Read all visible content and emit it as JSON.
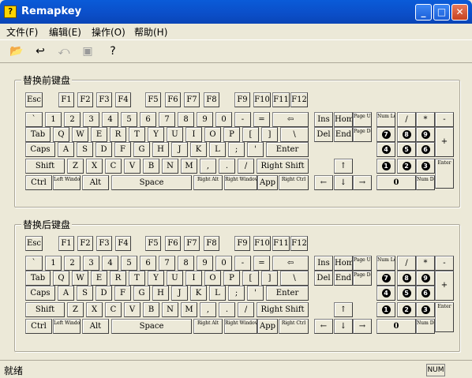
{
  "window": {
    "title": "Remapkey",
    "app_icon": "?"
  },
  "title_buttons": {
    "minimize": "_",
    "maximize": "□",
    "close": "✕"
  },
  "menu": [
    "文件(F)",
    "编辑(E)",
    "操作(O)",
    "帮助(H)"
  ],
  "toolbar_icons": [
    "open-file-icon",
    "reset-icon",
    "revert-icon",
    "stop-icon",
    "help-icon"
  ],
  "sections": [
    {
      "title": "替换前键盘"
    },
    {
      "title": "替换后键盘"
    }
  ],
  "keys": {
    "esc": "Esc",
    "f1": "F1",
    "f2": "F2",
    "f3": "F3",
    "f4": "F4",
    "f5": "F5",
    "f6": "F6",
    "f7": "F7",
    "f8": "F8",
    "f9": "F9",
    "f10": "F10",
    "f11": "F11",
    "f12": "F12",
    "backtick": "`",
    "k1": "1",
    "k2": "2",
    "k3": "3",
    "k4": "4",
    "k5": "5",
    "k6": "6",
    "k7": "7",
    "k8": "8",
    "k9": "9",
    "k0": "0",
    "minus": "-",
    "equals": "=",
    "backspace": "⇦",
    "tab": "Tab",
    "q": "Q",
    "w": "W",
    "e": "E",
    "r": "R",
    "t": "T",
    "y": "Y",
    "u": "U",
    "i": "I",
    "o": "O",
    "p": "P",
    "lbracket": "[",
    "rbracket": "]",
    "backslash": "\\",
    "caps": "Caps",
    "a": "A",
    "s": "S",
    "d": "D",
    "f": "F",
    "g": "G",
    "h": "H",
    "j": "J",
    "k": "K",
    "l": "L",
    "semicolon": ";",
    "quote": "'",
    "enter": "Enter",
    "lshift": "Shift",
    "z": "Z",
    "x": "X",
    "c": "C",
    "v": "V",
    "b": "B",
    "n": "N",
    "m": "M",
    "comma": ",",
    "period": ".",
    "slash": "/",
    "rshift": "Right Shift",
    "ctrl": "Ctrl",
    "lwin": "Left Windows",
    "alt": "Alt",
    "space": "Space",
    "ralt": "Right Alt",
    "rwin": "Right Windows",
    "app": "App",
    "rctrl": "Right Ctrl",
    "ins": "Ins",
    "home": "Home",
    "pgup": "Page Up",
    "del": "Del",
    "end": "End",
    "pgdn": "Page Down",
    "up": "↑",
    "left": "←",
    "down": "↓",
    "right": "→",
    "numlock": "Num Lock",
    "numdiv": "/",
    "nummul": "*",
    "numsub": "-",
    "num7": "7",
    "num8": "8",
    "num9": "9",
    "numadd": "+",
    "num4": "4",
    "num5": "5",
    "num6": "6",
    "num1": "1",
    "num2": "2",
    "num3": "3",
    "numenter": "Enter",
    "num0": "0",
    "numdel": "Num Del"
  },
  "status": {
    "text": "就绪",
    "num": "NUM"
  }
}
